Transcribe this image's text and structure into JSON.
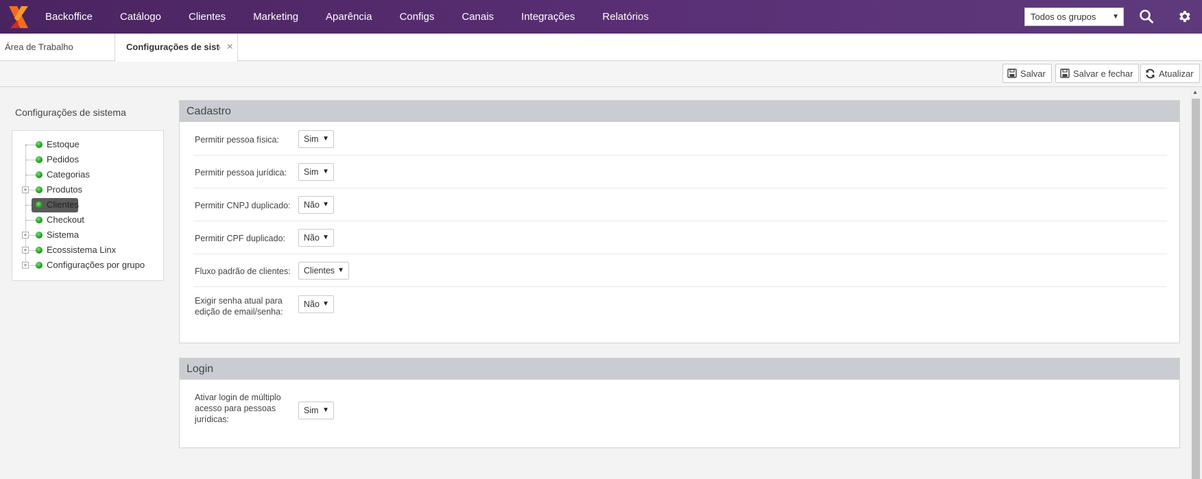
{
  "nav": {
    "items": [
      "Backoffice",
      "Catálogo",
      "Clientes",
      "Marketing",
      "Aparência",
      "Configs",
      "Canais",
      "Integrações",
      "Relatórios"
    ],
    "group_select": "Todos os grupos",
    "colors": {
      "bar": "#4a2460",
      "logo_orange": "#f26b1d",
      "logo_red": "#d9281e"
    }
  },
  "tabs": {
    "home": "Área de Trabalho",
    "active": "Configurações de sistema",
    "close": "×"
  },
  "toolbar": {
    "save": "Salvar",
    "save_close": "Salvar e fechar",
    "refresh": "Atualizar"
  },
  "sidebar": {
    "title": "Configurações de sistema",
    "items": [
      {
        "label": "Estoque",
        "expandable": false,
        "selected": false
      },
      {
        "label": "Pedidos",
        "expandable": false,
        "selected": false
      },
      {
        "label": "Categorias",
        "expandable": false,
        "selected": false
      },
      {
        "label": "Produtos",
        "expandable": true,
        "selected": false
      },
      {
        "label": "Clientes",
        "expandable": false,
        "selected": true
      },
      {
        "label": "Checkout",
        "expandable": false,
        "selected": false
      },
      {
        "label": "Sistema",
        "expandable": true,
        "selected": false
      },
      {
        "label": "Ecossistema Linx",
        "expandable": true,
        "selected": false
      },
      {
        "label": "Configurações por grupo",
        "expandable": true,
        "selected": false
      }
    ],
    "expander_glyph": "+"
  },
  "cadastro": {
    "title": "Cadastro",
    "rows": [
      {
        "label": "Permitir pessoa física:",
        "value": "Sim"
      },
      {
        "label": "Permitir pessoa jurídica:",
        "value": "Sim"
      },
      {
        "label": "Permitir CNPJ duplicado:",
        "value": "Não"
      },
      {
        "label": "Permitir CPF duplicado:",
        "value": "Não"
      },
      {
        "label": "Fluxo padrão de clientes:",
        "value": "Clientes"
      },
      {
        "label_line1": "Exigir senha atual para",
        "label_line2": "edição de email/senha:",
        "value": "Não"
      }
    ]
  },
  "login": {
    "title": "Login",
    "rows": [
      {
        "label_line1": "Ativar login de múltiplo",
        "label_line2": "acesso para pessoas",
        "label_line3": "jurídicas:",
        "value": "Sim"
      }
    ]
  },
  "icons": {
    "caret": "▼",
    "scroll_up": "▲"
  }
}
